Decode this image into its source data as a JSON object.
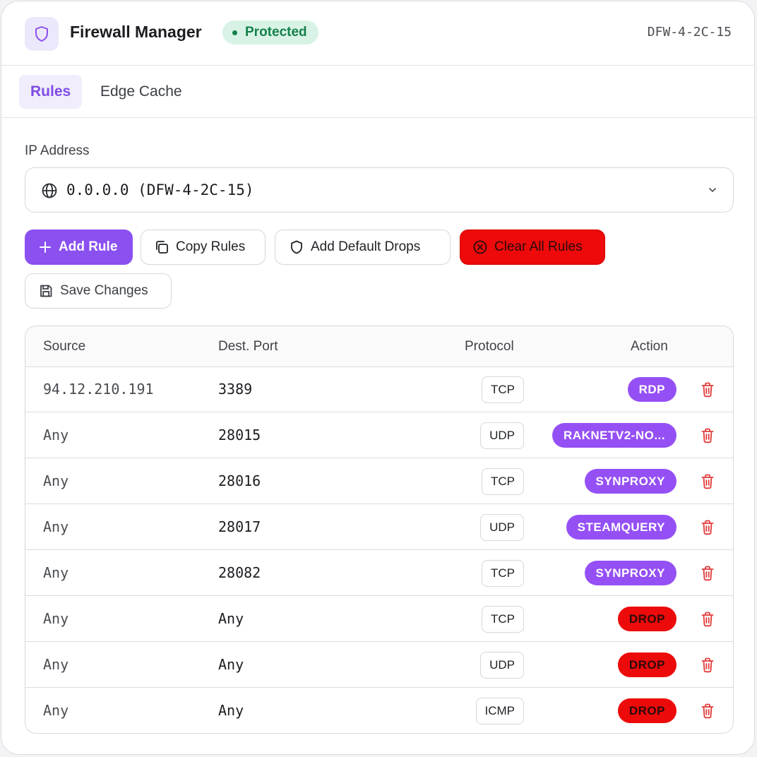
{
  "header": {
    "logo_icon": "shield-icon",
    "title": "Firewall Manager",
    "status": "Protected",
    "server_id": "DFW-4-2C-15"
  },
  "tabs": [
    {
      "label": "Rules",
      "active": true
    },
    {
      "label": "Edge Cache",
      "active": false
    }
  ],
  "ip_field": {
    "label": "IP Address",
    "value": "0.0.0.0 (DFW-4-2C-15)",
    "icon": "globe-icon"
  },
  "toolbar": {
    "add_rule": "Add Rule",
    "copy_rules": "Copy Rules",
    "add_default_drops": "Add Default Drops",
    "clear_all_rules": "Clear All Rules",
    "save_changes": "Save Changes"
  },
  "table": {
    "columns": {
      "source": "Source",
      "dest_port": "Dest. Port",
      "protocol": "Protocol",
      "action": "Action"
    },
    "rows": [
      {
        "source": "94.12.210.191",
        "port": "3389",
        "protocol": "TCP",
        "action": "RDP",
        "action_color": "#9550f5"
      },
      {
        "source": "Any",
        "port": "28015",
        "protocol": "UDP",
        "action": "RAKNETV2-NO...",
        "action_color": "#9550f5"
      },
      {
        "source": "Any",
        "port": "28016",
        "protocol": "TCP",
        "action": "SYNPROXY",
        "action_color": "#9550f5"
      },
      {
        "source": "Any",
        "port": "28017",
        "protocol": "UDP",
        "action": "STEAMQUERY",
        "action_color": "#9550f5"
      },
      {
        "source": "Any",
        "port": "28082",
        "protocol": "TCP",
        "action": "SYNPROXY",
        "action_color": "#9550f5"
      },
      {
        "source": "Any",
        "port": "Any",
        "protocol": "TCP",
        "action": "DROP",
        "action_color": "#ec0a0a"
      },
      {
        "source": "Any",
        "port": "Any",
        "protocol": "UDP",
        "action": "DROP",
        "action_color": "#ec0a0a"
      },
      {
        "source": "Any",
        "port": "Any",
        "protocol": "ICMP",
        "action": "DROP",
        "action_color": "#ec0a0a"
      }
    ]
  },
  "colors": {
    "accent": "#8b50f0",
    "danger": "#ee0a0a",
    "success_bg": "#d8f3e6",
    "success_text": "#14804a"
  }
}
